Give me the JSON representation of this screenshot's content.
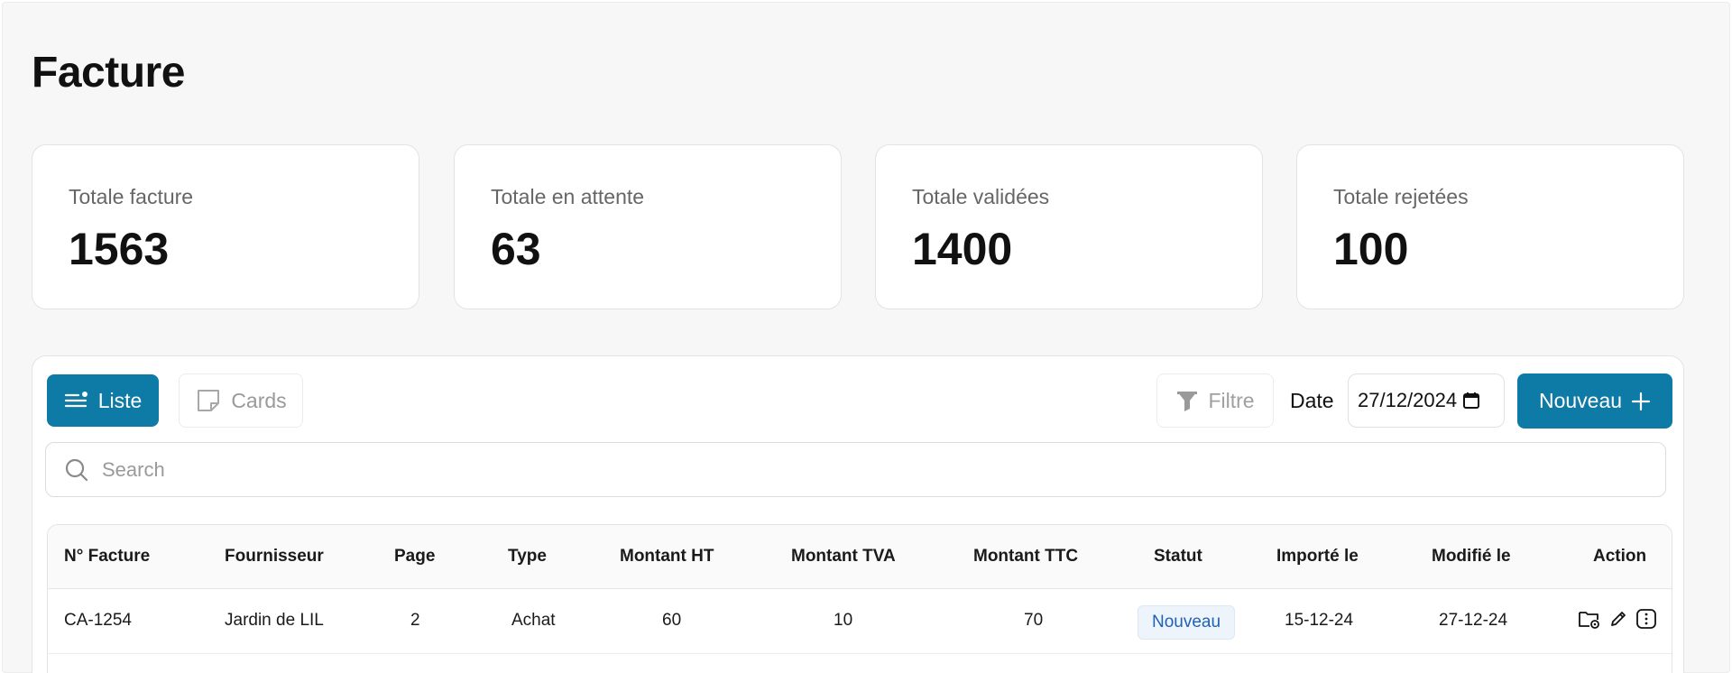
{
  "page": {
    "title": "Facture"
  },
  "stats": [
    {
      "label": "Totale facture",
      "value": "1563"
    },
    {
      "label": "Totale en attente",
      "value": "63"
    },
    {
      "label": "Totale validées",
      "value": "1400"
    },
    {
      "label": "Totale rejetées",
      "value": "100"
    }
  ],
  "toolbar": {
    "liste_label": "Liste",
    "cards_label": "Cards",
    "filtre_label": "Filtre",
    "date_label": "Date",
    "date_value": "27/12/2024",
    "nouveau_label": "Nouveau"
  },
  "search": {
    "placeholder": "Search"
  },
  "table": {
    "headers": [
      "N° Facture",
      "Fournisseur",
      "Page",
      "Type",
      "Montant HT",
      "Montant TVA",
      "Montant TTC",
      "Statut",
      "Importé le",
      "Modifié le",
      "Action"
    ],
    "rows": [
      {
        "numero": "CA-1254",
        "fournisseur": "Jardin de LIL",
        "page": "2",
        "type": "Achat",
        "montant_ht": "60",
        "montant_tva": "10",
        "montant_ttc": "70",
        "statut": "Nouveau",
        "importe_le": "15-12-24",
        "modifie_le": "27-12-24"
      }
    ]
  },
  "colors": {
    "primary": "#0e7aa6",
    "badge_text": "#1e62b5",
    "background": "#f7f7f7"
  },
  "icons": [
    "list-icon",
    "cards-icon",
    "filter-icon",
    "calendar-icon",
    "plus-icon",
    "search-icon",
    "folder-view-icon",
    "edit-icon",
    "more-icon"
  ]
}
